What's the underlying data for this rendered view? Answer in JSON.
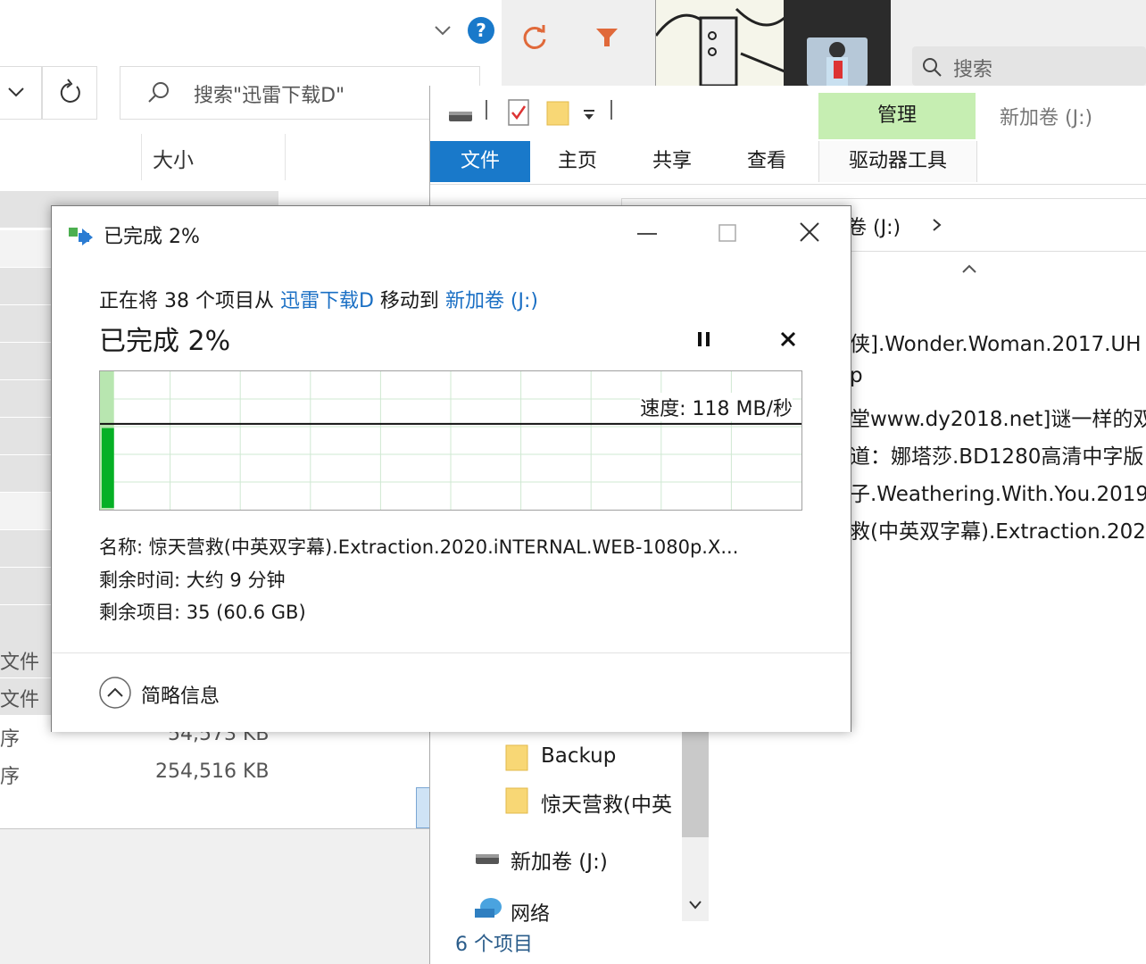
{
  "left_window": {
    "search_placeholder": "搜索\"迅雷下载D\"",
    "column_size": "大小",
    "type_labels": [
      "文件",
      "文件",
      "序",
      "序"
    ],
    "sizes": [
      "54,573 KB",
      "254,516 KB"
    ]
  },
  "top_right": {
    "search_placeholder": "搜索"
  },
  "right_window": {
    "manage_tab": "管理",
    "window_title": "新加卷 (J:)",
    "tabs": [
      "文件",
      "主页",
      "共享",
      "查看",
      "驱动器工具"
    ],
    "breadcrumb": "卷 (J:)",
    "file_names": [
      "侠].Wonder.Woman.2017.UH",
      "p",
      "堂www.dy2018.net]谜一样的双",
      "道：娜塔莎.BD1280高清中字版",
      "子.Weathering.With.You.2019",
      "救(中英双字幕).Extraction.2020"
    ],
    "nav_items": [
      "Backup",
      "惊天营救(中英",
      "新加卷 (J:)",
      "网络"
    ],
    "status": "6 个项目"
  },
  "dialog": {
    "title": "已完成 2%",
    "line1_prefix": "正在将 38 个项目从 ",
    "source": "迅雷下载D",
    "line1_mid": " 移动到 ",
    "destination": "新加卷 (J:)",
    "progress_heading": "已完成 2%",
    "speed": "速度: 118 MB/秒",
    "name_line": "名称: 惊天营救(中英双字幕).Extraction.2020.iNTERNAL.WEB-1080p.X...",
    "time_line": "剩余时间: 大约 9 分钟",
    "items_line": "剩余项目: 35 (60.6 GB)",
    "details_toggle": "简略信息",
    "progress_fraction": 0.02
  },
  "colors": {
    "accent_blue": "#1979ca",
    "link_blue": "#1a6fc4",
    "progress_green": "#06b025",
    "manage_green": "#c6eeb2"
  }
}
